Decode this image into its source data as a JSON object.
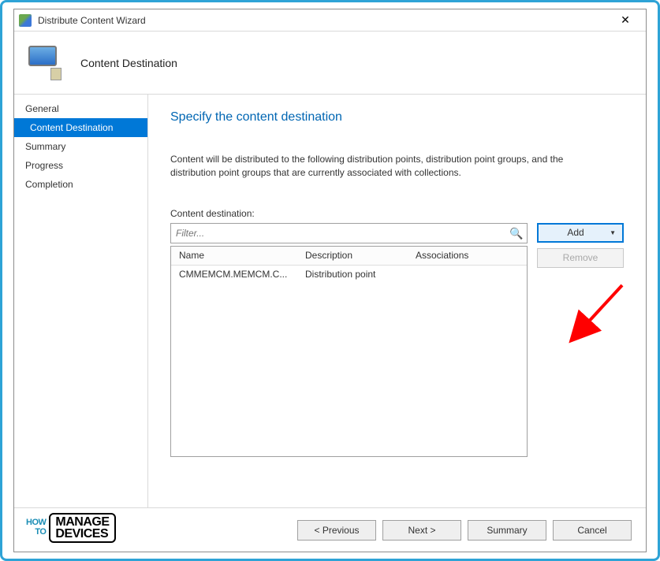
{
  "window": {
    "title": "Distribute Content Wizard",
    "close": "✕"
  },
  "header": {
    "title": "Content Destination"
  },
  "sidebar": {
    "items": [
      {
        "label": "General",
        "active": false
      },
      {
        "label": "Content Destination",
        "active": true
      },
      {
        "label": "Summary",
        "active": false
      },
      {
        "label": "Progress",
        "active": false
      },
      {
        "label": "Completion",
        "active": false
      }
    ]
  },
  "content": {
    "heading": "Specify the content destination",
    "description": "Content will be distributed to the following distribution points, distribution point groups, and the distribution point groups that are currently associated with collections.",
    "destination_label": "Content destination:",
    "filter_placeholder": "Filter...",
    "table": {
      "columns": [
        "Name",
        "Description",
        "Associations"
      ],
      "rows": [
        {
          "name": "CMMEMCM.MEMCM.C...",
          "description": "Distribution point",
          "associations": ""
        }
      ]
    },
    "buttons": {
      "add": "Add",
      "remove": "Remove"
    }
  },
  "footer": {
    "previous": "<  Previous",
    "next": "Next  >",
    "summary": "Summary",
    "cancel": "Cancel"
  },
  "watermark": {
    "how": "HOW",
    "to": "TO",
    "manage": "MANAGE",
    "devices": "DEVICES"
  }
}
